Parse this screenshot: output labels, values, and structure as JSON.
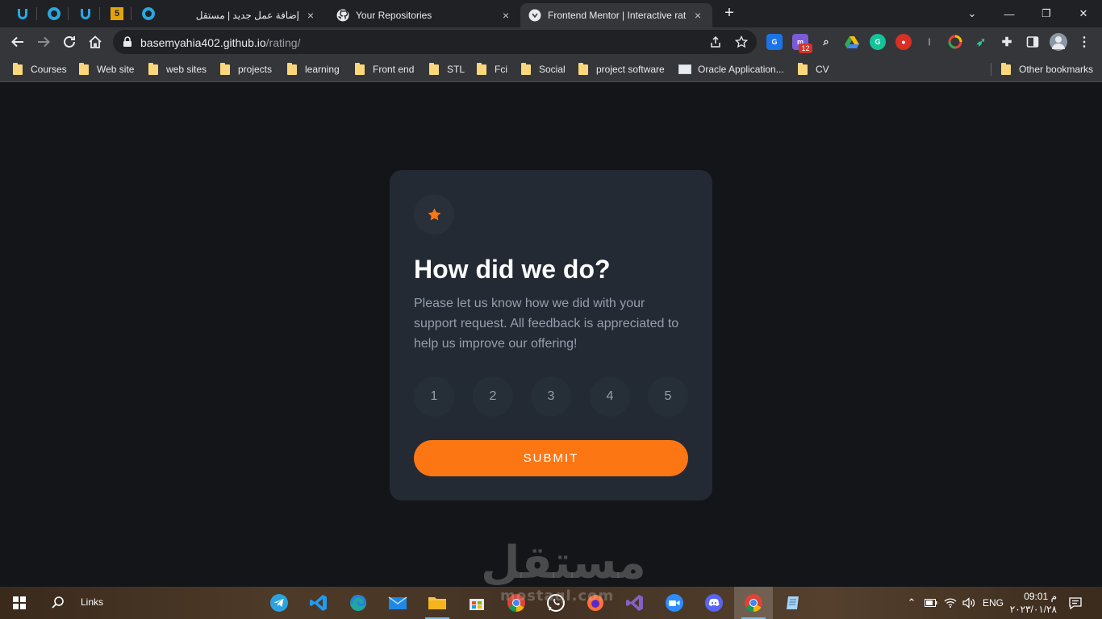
{
  "browser": {
    "pinned_tabs": [
      {
        "icon": "udemy-u-icon"
      },
      {
        "icon": "ring-icon"
      },
      {
        "icon": "udemy-u-icon"
      },
      {
        "icon": "html5-icon",
        "label": "5"
      },
      {
        "icon": "ring-icon"
      }
    ],
    "tabs": [
      {
        "title": "إضافة عمل جديد | مستقل",
        "close": "×"
      },
      {
        "title": "Your Repositories",
        "close": "×"
      },
      {
        "title": "Frontend Mentor | Interactive rat",
        "close": "×",
        "active": true
      }
    ],
    "new_tab": "+",
    "window_controls": {
      "chevron": "⌄",
      "minimize": "—",
      "restore": "❐",
      "close": "✕"
    }
  },
  "toolbar": {
    "url_host": "basemyahia402.github.io",
    "url_path": "/rating/",
    "extension_badge": "12"
  },
  "bookmarks": {
    "items": [
      "Courses",
      "Web site",
      "web sites",
      "projects",
      "learning",
      "Front end",
      "STL",
      "Fci",
      "Social",
      "project software",
      "Oracle Application...",
      "CV"
    ],
    "other": "Other bookmarks"
  },
  "card": {
    "title": "How did we do?",
    "description": "Please let us know how we did with your support request. All feedback is appreciated to help us improve our offering!",
    "ratings": [
      "1",
      "2",
      "3",
      "4",
      "5"
    ],
    "submit_label": "SUBMIT",
    "accent_color": "#fc7614"
  },
  "watermark": {
    "text": "مستقل",
    "sub": "mostaql.com"
  },
  "taskbar": {
    "links_label": "Links",
    "language": "ENG",
    "time": "09:01 م",
    "date": "٢٠٢٣/٠١/٢٨"
  }
}
